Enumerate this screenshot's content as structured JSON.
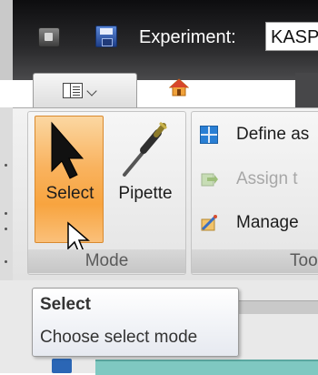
{
  "titlebar": {
    "experiment_label": "Experiment:",
    "experiment_value": "KASP",
    "icons": [
      "app-system-icon",
      "save-icon"
    ]
  },
  "tabs": {
    "app_menu_icon": "menu-icon",
    "home_label": "Home"
  },
  "ribbon": {
    "mode_group": {
      "label": "Mode",
      "select_label": "Select",
      "pipette_label": "Pipette",
      "select_state": "highlighted"
    },
    "tools_group": {
      "label": "Too",
      "items": [
        {
          "label": "Define as",
          "icon": "grid-icon",
          "enabled": true
        },
        {
          "label": "Assign t",
          "icon": "assign-icon",
          "enabled": false
        },
        {
          "label": "Manage",
          "icon": "manage-icon",
          "enabled": true
        }
      ]
    }
  },
  "tooltip": {
    "title": "Select",
    "description": "Choose select mode"
  },
  "colors": {
    "select_highlight": "#f8a43f",
    "titlebar": "#1a1a1c",
    "ribbon": "#e8e8e8"
  }
}
